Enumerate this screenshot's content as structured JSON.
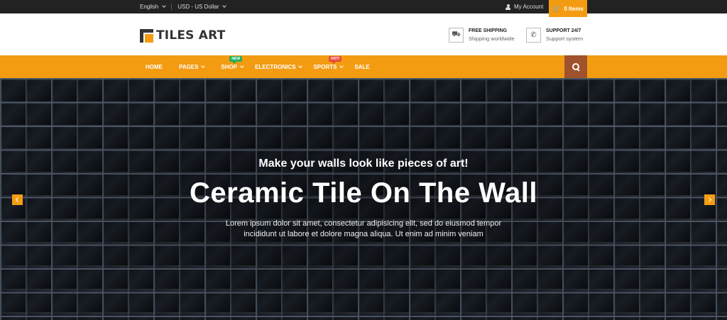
{
  "topbar": {
    "language": "English",
    "currency": "USD - US Dollar",
    "account": "My Account"
  },
  "cart": {
    "label": "0 Items"
  },
  "brand": {
    "name": "TILES ART",
    "accent_color": "#f39c12"
  },
  "features": [
    {
      "title": "FREE SHIPPING",
      "subtitle": "Shipping worldwide",
      "icon": "truck-icon"
    },
    {
      "title": "SUPPORT 24/7",
      "subtitle": "Support system",
      "icon": "phone-icon"
    }
  ],
  "nav": {
    "items": [
      {
        "label": "HOME",
        "dropdown": false
      },
      {
        "label": "PAGES",
        "dropdown": true
      },
      {
        "label": "SHOP",
        "dropdown": true,
        "badge": "NEW"
      },
      {
        "label": "ELECTRONICS",
        "dropdown": true
      },
      {
        "label": "SPORTS",
        "dropdown": true,
        "badge": "HOT!"
      },
      {
        "label": "SALE",
        "dropdown": false
      }
    ]
  },
  "hero": {
    "subtitle": "Make your walls look like pieces of art!",
    "title": "Ceramic Tile On The Wall",
    "description": "Lorem ipsum dolor sit amet, consectetur adipisicing elit, sed do eiusmod tempor incididunt ut labore et dolore magna aliqua. Ut enim ad minim veniam"
  }
}
